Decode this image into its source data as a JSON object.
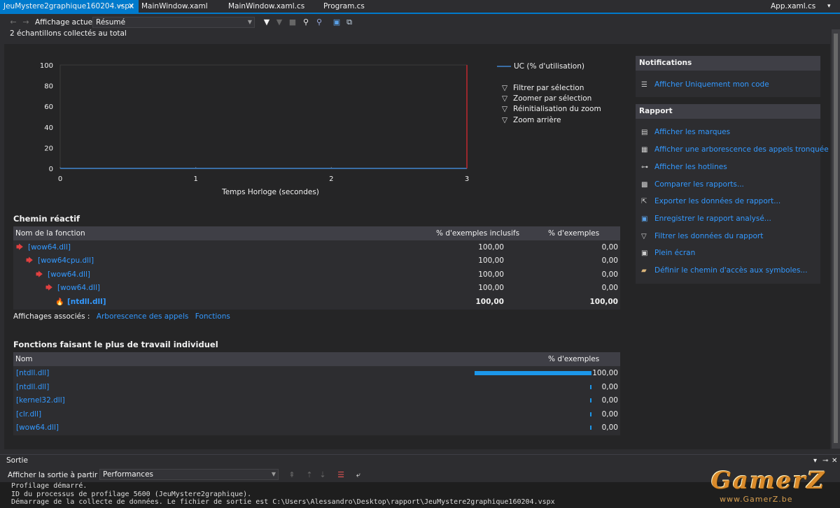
{
  "tabs": [
    {
      "label": "JeuMystere2graphique160204.vspx",
      "active": true
    },
    {
      "label": "MainWindow.xaml",
      "active": false
    },
    {
      "label": "MainWindow.xaml.cs",
      "active": false
    },
    {
      "label": "Program.cs",
      "active": false
    },
    {
      "label": "App.xaml.cs",
      "active": false
    }
  ],
  "toolbar": {
    "current_view_label": "Affichage actuel :",
    "current_view_value": "Résumé"
  },
  "summary_text": "2 échantillons collectés au total",
  "chart_data": {
    "type": "line",
    "xlabel": "Temps Horloge (secondes)",
    "ylabel": "",
    "xlim": [
      0,
      3
    ],
    "ylim": [
      0,
      100
    ],
    "x_ticks": [
      "0",
      "1",
      "2",
      "3"
    ],
    "y_ticks": [
      "100",
      "80",
      "60",
      "40",
      "20",
      "0"
    ],
    "series": [
      {
        "name": "UC (% d'utilisation)",
        "x": [
          0,
          3
        ],
        "y": [
          0,
          0
        ],
        "color": "#3a6ea5"
      }
    ],
    "marker_line_x": 3,
    "marker_color": "#c0282e",
    "legend": "right",
    "grid": false
  },
  "chart_actions": [
    "Filtrer par sélection",
    "Zoomer par sélection",
    "Réinitialisation du zoom",
    "Zoom arrière"
  ],
  "notifications": {
    "title": "Notifications",
    "links": [
      "Afficher Uniquement mon code"
    ]
  },
  "rapport": {
    "title": "Rapport",
    "links": [
      "Afficher les marques",
      "Afficher une arborescence des appels tronquée",
      "Afficher les hotlines",
      "Comparer les rapports...",
      "Exporter les données de rapport...",
      "Enregistrer le rapport analysé...",
      "Filtrer les données du rapport",
      "Plein écran",
      "Définir le chemin d'accès aux symboles..."
    ]
  },
  "hot_path": {
    "title": "Chemin réactif",
    "headers": [
      "Nom de la fonction",
      "% d'exemples inclusifs",
      "% d'exemples exclusifs"
    ],
    "rows": [
      {
        "name": "[wow64.dll]",
        "inclusive": "100,00",
        "exclusive": "0,00"
      },
      {
        "name": "[wow64cpu.dll]",
        "inclusive": "100,00",
        "exclusive": "0,00"
      },
      {
        "name": "[wow64.dll]",
        "inclusive": "100,00",
        "exclusive": "0,00"
      },
      {
        "name": "[wow64.dll]",
        "inclusive": "100,00",
        "exclusive": "0,00"
      },
      {
        "name": "[ntdll.dll]",
        "inclusive": "100,00",
        "exclusive": "100,00"
      }
    ]
  },
  "related_views": {
    "label": "Affichages associés :",
    "links": [
      "Arborescence des appels",
      "Fonctions"
    ]
  },
  "top_functions": {
    "title": "Fonctions faisant le plus de travail individuel",
    "headers": [
      "Nom",
      "% d'exemples exclusifs"
    ],
    "rows": [
      {
        "name": "[ntdll.dll]",
        "value": "100,00",
        "fraction": 1.0
      },
      {
        "name": "[ntdll.dll]",
        "value": "0,00",
        "fraction": 0.0
      },
      {
        "name": "[kernel32.dll]",
        "value": "0,00",
        "fraction": 0.0
      },
      {
        "name": "[clr.dll]",
        "value": "0,00",
        "fraction": 0.0
      },
      {
        "name": "[wow64.dll]",
        "value": "0,00",
        "fraction": 0.0
      }
    ]
  },
  "output": {
    "title": "Sortie",
    "show_from_label": "Afficher la sortie à partir de :",
    "show_from_value": "Performances",
    "lines": [
      "Profilage démarré.",
      "ID du processus de profilage 5600 (JeuMystere2graphique).",
      "Démarrage de la collecte de données. Le fichier de sortie est C:\\Users\\Alessandro\\Desktop\\rapport\\JeuMystere2graphique160204.vspx"
    ]
  },
  "watermark": {
    "big": "GamerZ",
    "small": "www.GamerZ.be"
  },
  "colors": {
    "accent": "#007acc",
    "link": "#3399ff",
    "bar": "#1c97ea"
  }
}
